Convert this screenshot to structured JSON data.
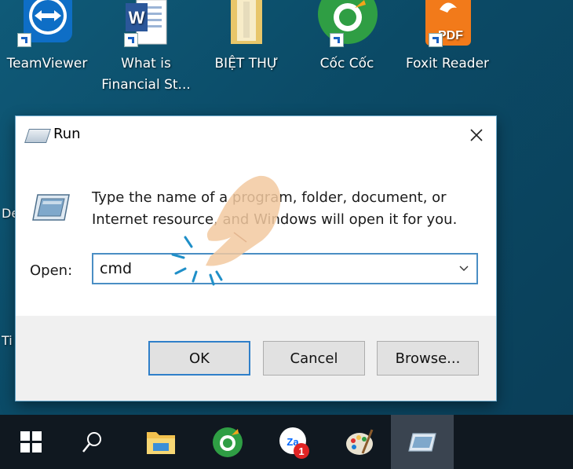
{
  "desktop": {
    "icons": [
      {
        "label": "TeamViewer"
      },
      {
        "label": "What is Financial St..."
      },
      {
        "label": "BIỆT THỰ"
      },
      {
        "label": "Cốc Cốc"
      },
      {
        "label": "Foxit Reader"
      }
    ],
    "edge_text": [
      "De",
      "Ti"
    ]
  },
  "run_dialog": {
    "title": "Run",
    "description": "Type the name of a program, folder, document, or Internet resource, and Windows will open it for you.",
    "open_label": "Open:",
    "open_value": "cmd",
    "ok_label": "OK",
    "cancel_label": "Cancel",
    "browse_label": "Browse..."
  },
  "taskbar": {
    "items": [
      "windows-start-icon",
      "search-icon",
      "file-explorer-icon",
      "coccoc-browser-icon",
      "zalo-icon",
      "paint-icon",
      "run-icon"
    ],
    "zalo_badge": "1",
    "zalo_text": "Za"
  },
  "colors": {
    "desktop": "#0d4f6a",
    "dialog_bg": "#f0f0f0",
    "accent": "#2f7fc9",
    "taskbar": "#101820"
  }
}
